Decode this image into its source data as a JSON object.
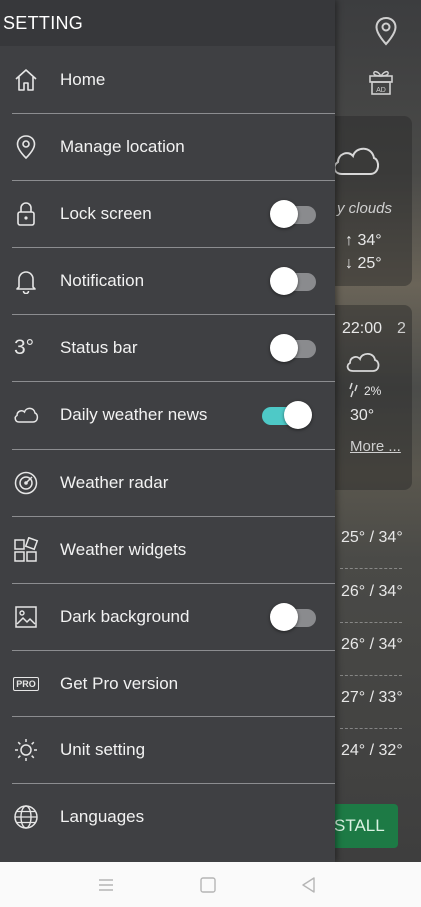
{
  "drawer": {
    "title": "SETTING",
    "items": [
      {
        "label": "Home",
        "icon": "home-icon"
      },
      {
        "label": "Manage location",
        "icon": "location-pin-icon"
      },
      {
        "label": "Lock screen",
        "icon": "lock-icon",
        "toggle": "off"
      },
      {
        "label": "Notification",
        "icon": "bell-icon",
        "toggle": "off"
      },
      {
        "label": "Status bar",
        "icon": "status-bar-temp-icon",
        "icon_text": "3°",
        "toggle": "off"
      },
      {
        "label": "Daily weather news",
        "icon": "cloud-icon",
        "toggle": "on"
      },
      {
        "label": "Weather radar",
        "icon": "radar-icon"
      },
      {
        "label": "Weather widgets",
        "icon": "widgets-icon"
      },
      {
        "label": "Dark background",
        "icon": "image-icon",
        "toggle": "off"
      },
      {
        "label": "Get Pro version",
        "icon": "pro-badge-icon",
        "icon_text": "PRO"
      },
      {
        "label": "Unit setting",
        "icon": "sun-icon"
      },
      {
        "label": "Languages",
        "icon": "globe-icon"
      }
    ],
    "toggle_on_color": "#4ec9c7"
  },
  "background": {
    "condition": "y clouds",
    "high": "34°",
    "low": "25°",
    "hour_time": "22:00",
    "hour_extra": "2",
    "precip": "2%",
    "hour_temp": "30°",
    "more": "More ...",
    "daily": [
      "25° / 34°",
      "26° / 34°",
      "26° / 34°",
      "27° / 33°",
      "24° / 32°"
    ],
    "install": "STALL"
  }
}
